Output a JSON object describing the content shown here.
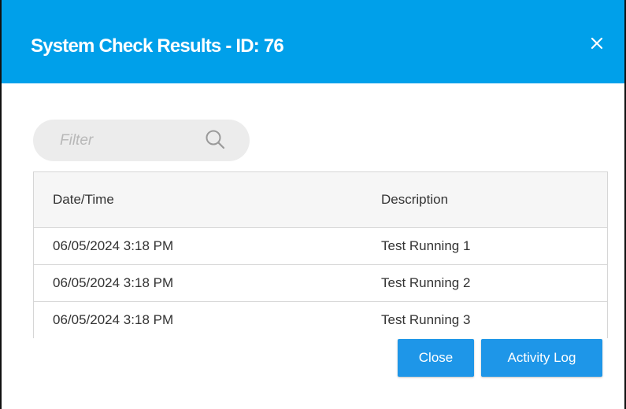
{
  "dialog": {
    "title": "System Check Results - ID: 76",
    "close_icon": "close-icon",
    "accent_color": "#00a0ea"
  },
  "filter": {
    "placeholder": "Filter",
    "value": "",
    "icon": "search-icon"
  },
  "table": {
    "columns": [
      "Date/Time",
      "Description"
    ],
    "rows": [
      [
        "06/05/2024 3:18 PM",
        "Test Running 1"
      ],
      [
        "06/05/2024 3:18 PM",
        "Test Running 2"
      ],
      [
        "06/05/2024 3:18 PM",
        "Test Running 3"
      ]
    ]
  },
  "footer": {
    "close_label": "Close",
    "activity_log_label": "Activity Log",
    "button_color": "#1e96e8"
  }
}
